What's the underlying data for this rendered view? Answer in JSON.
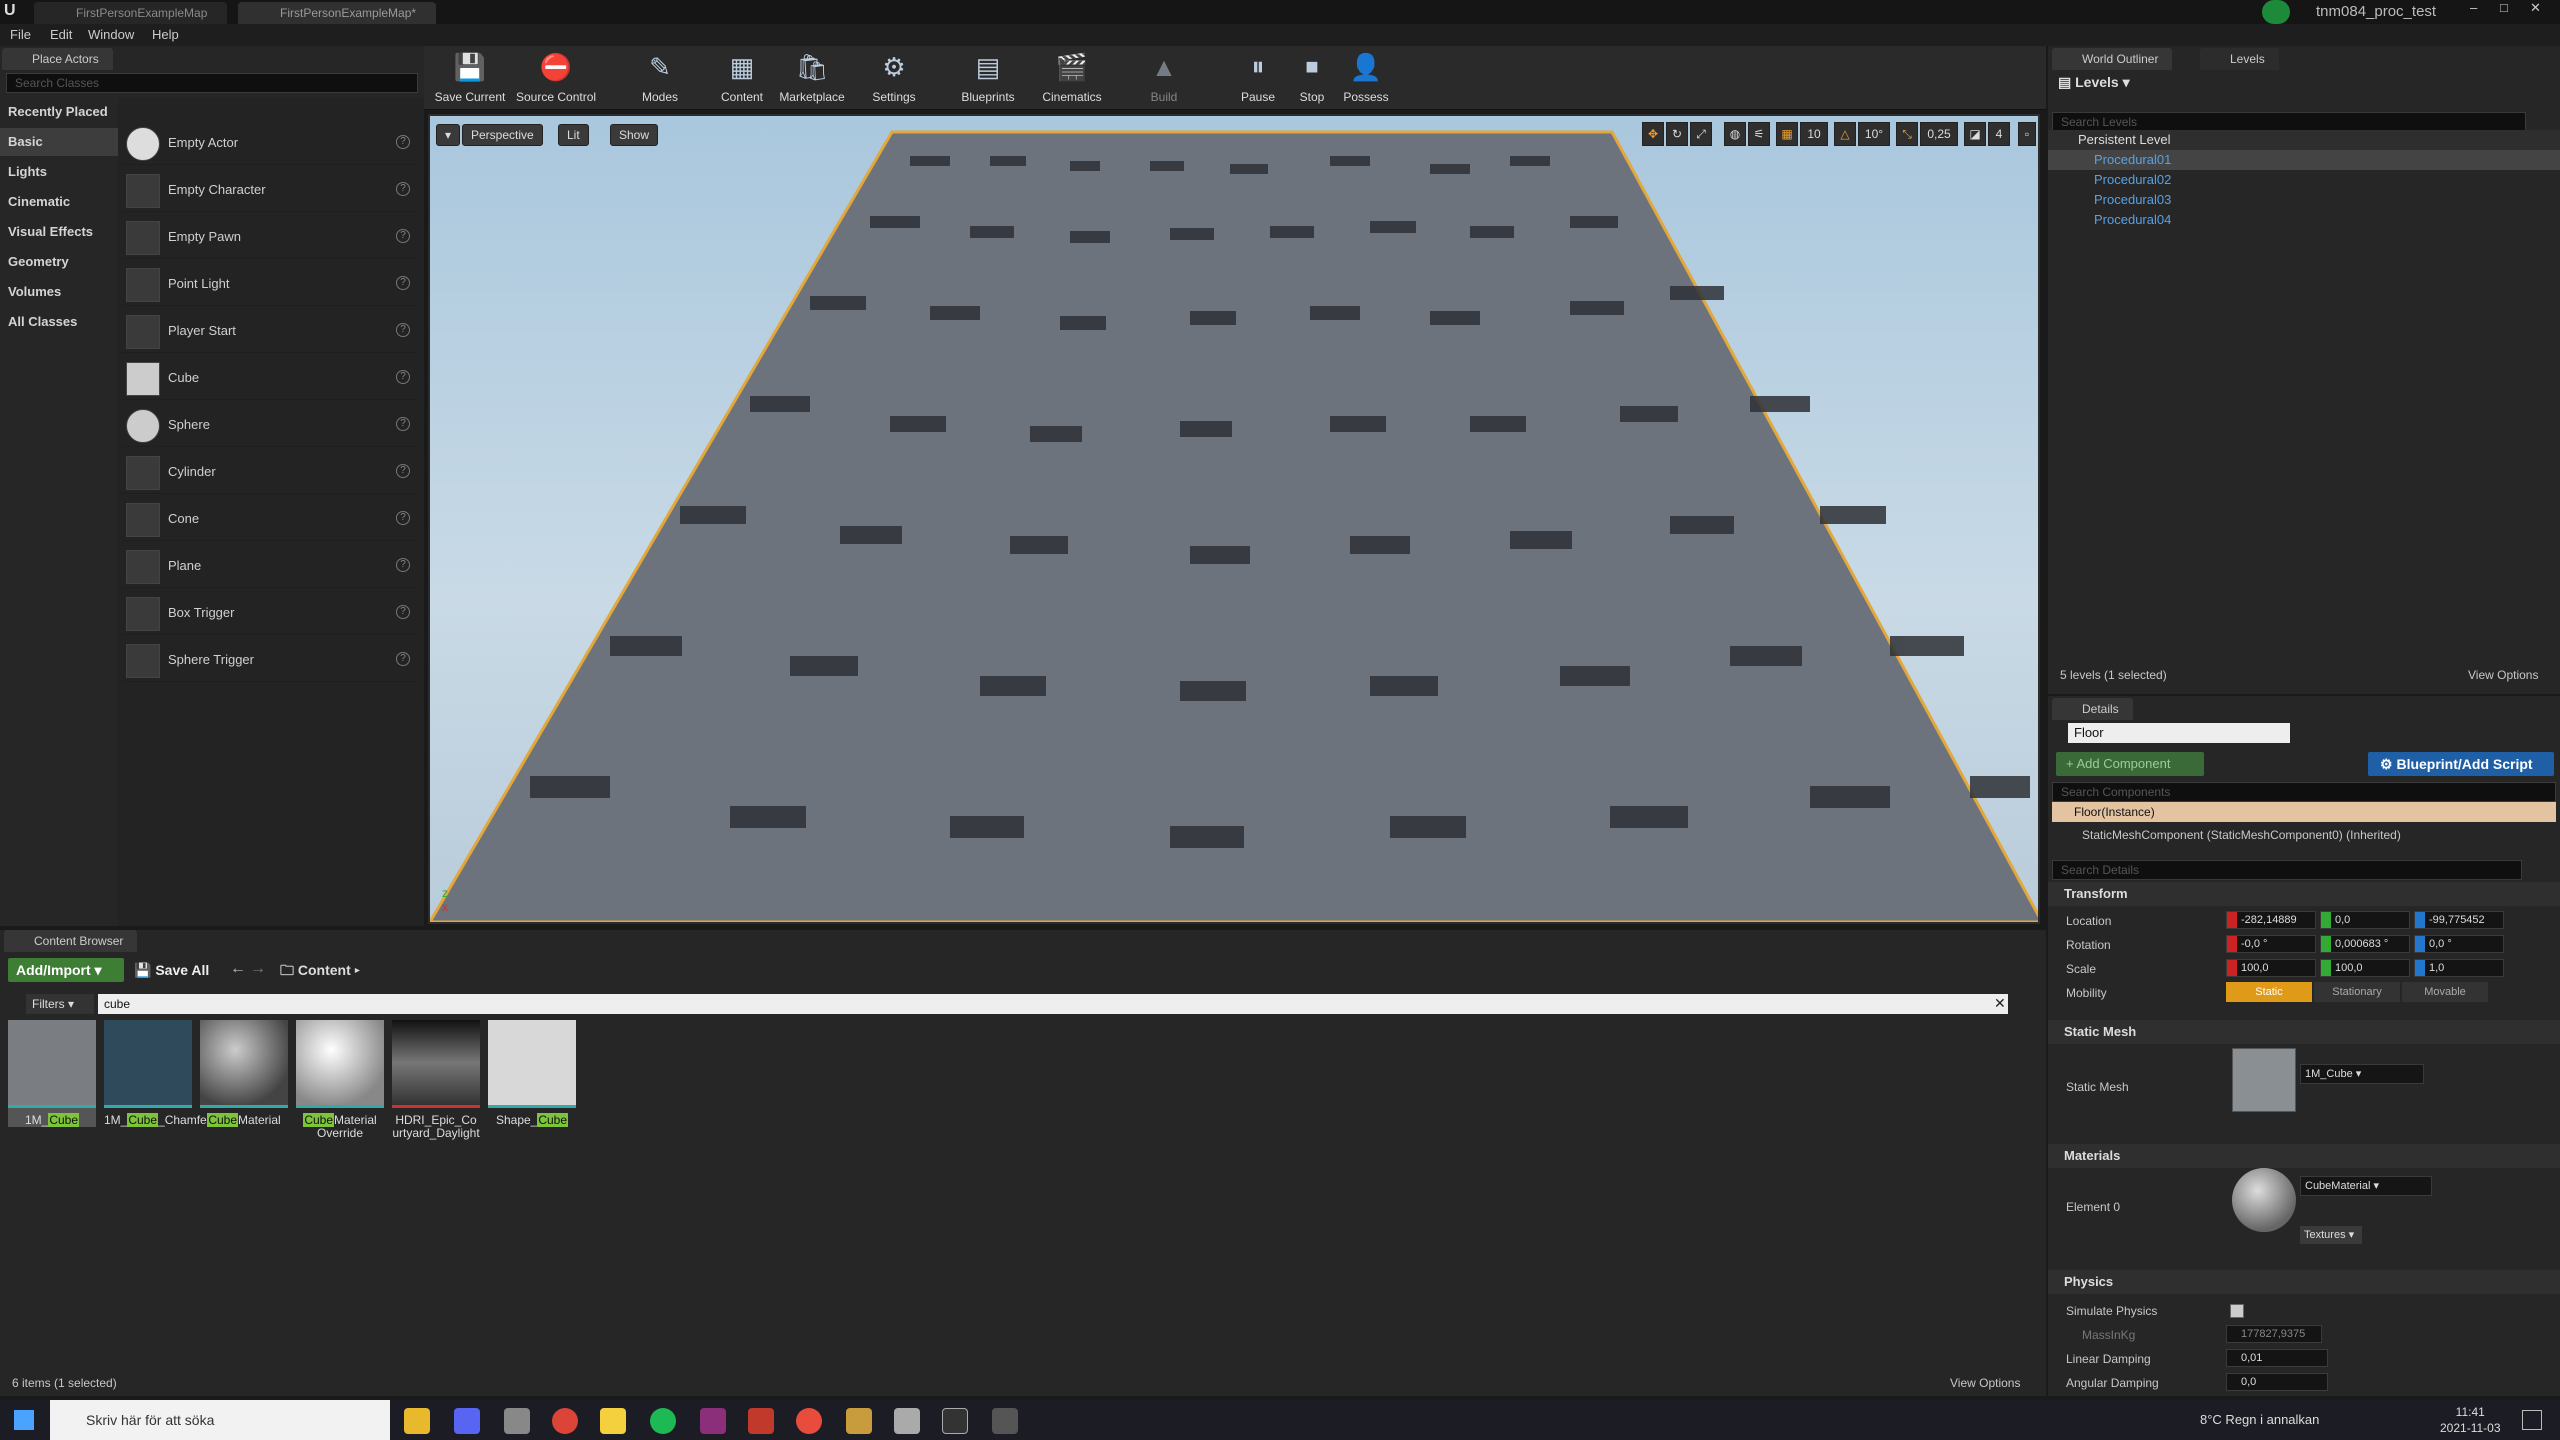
{
  "tabs": [
    "FirstPersonExampleMap",
    "FirstPersonExampleMap*"
  ],
  "project_name": "tnm084_proc_test",
  "menu": [
    "File",
    "Edit",
    "Window",
    "Help"
  ],
  "place_actors": {
    "title": "Place Actors",
    "search_placeholder": "Search Classes",
    "categories": [
      "Recently Placed",
      "Basic",
      "Lights",
      "Cinematic",
      "Visual Effects",
      "Geometry",
      "Volumes",
      "All Classes"
    ],
    "selected_category": "Basic",
    "actors": [
      "Empty Actor",
      "Empty Character",
      "Empty Pawn",
      "Point Light",
      "Player Start",
      "Cube",
      "Sphere",
      "Cylinder",
      "Cone",
      "Plane",
      "Box Trigger",
      "Sphere Trigger"
    ]
  },
  "toolbar": {
    "save_current": "Save Current",
    "source_control": "Source Control",
    "modes": "Modes",
    "content": "Content",
    "marketplace": "Marketplace",
    "settings": "Settings",
    "blueprints": "Blueprints",
    "cinematics": "Cinematics",
    "build": "Build",
    "pause": "Pause",
    "stop": "Stop",
    "possess": "Possess"
  },
  "viewport": {
    "perspective": "Perspective",
    "lit": "Lit",
    "show": "Show",
    "grid_snap": "10",
    "rot_snap": "10°",
    "scale_snap": "0,25",
    "cam_speed": "4"
  },
  "outliner": {
    "tab_world": "World Outliner",
    "tab_levels": "Levels",
    "levels_label": "Levels",
    "search_placeholder": "Search Levels",
    "persistent": "Persistent Level",
    "levels": [
      "Procedural01",
      "Procedural02",
      "Procedural03",
      "Procedural04"
    ],
    "status": "5 levels (1 selected)",
    "view_options": "View Options"
  },
  "details": {
    "tab": "Details",
    "name": "Floor",
    "add_component": "+ Add Component",
    "blueprint_script": "Blueprint/Add Script",
    "search_components": "Search Components",
    "instance": "Floor(Instance)",
    "component": "StaticMeshComponent (StaticMeshComponent0) (Inherited)",
    "search_details": "Search Details",
    "transform": "Transform",
    "location_label": "Location",
    "location": [
      "-282,14889",
      "0,0",
      "-99,775452"
    ],
    "rotation_label": "Rotation",
    "rotation": [
      "-0,0 °",
      "0,000683 °",
      "0,0 °"
    ],
    "scale_label": "Scale",
    "scale": [
      "100,0",
      "100,0",
      "1,0"
    ],
    "mobility_label": "Mobility",
    "mobility": [
      "Static",
      "Stationary",
      "Movable"
    ],
    "static_mesh_section": "Static Mesh",
    "static_mesh_label": "Static Mesh",
    "static_mesh_value": "1M_Cube",
    "materials_section": "Materials",
    "element0_label": "Element 0",
    "element0_value": "CubeMaterial",
    "textures": "Textures",
    "physics_section": "Physics",
    "simulate_physics": "Simulate Physics",
    "mass_label": "MassInKg",
    "mass_value": "177827,9375",
    "linear_damping_label": "Linear Damping",
    "linear_damping": "0,01",
    "angular_damping_label": "Angular Damping",
    "angular_damping": "0,0"
  },
  "content_browser": {
    "tab": "Content Browser",
    "add_import": "Add/Import",
    "save_all": "Save All",
    "path": "Content",
    "filters": "Filters",
    "search_value": "cube",
    "assets": [
      {
        "pre": "1M_",
        "hl": "Cube",
        "post": ""
      },
      {
        "pre": "1M_",
        "hl": "Cube",
        "post": "_Chamfer"
      },
      {
        "pre": "",
        "hl": "Cube",
        "post": "Material"
      },
      {
        "pre": "",
        "hl": "Cube",
        "post": "Material Override"
      },
      {
        "pre": "HDRI_Epic_Courtyard_Daylight",
        "hl": "",
        "post": ""
      },
      {
        "pre": "Shape_",
        "hl": "Cube",
        "post": ""
      }
    ],
    "status": "6 items (1 selected)",
    "view_options": "View Options"
  },
  "taskbar": {
    "search_placeholder": "Skriv här för att söka",
    "weather": "8°C Regn i annalkan",
    "time": "11:41",
    "date": "2021-11-03"
  }
}
